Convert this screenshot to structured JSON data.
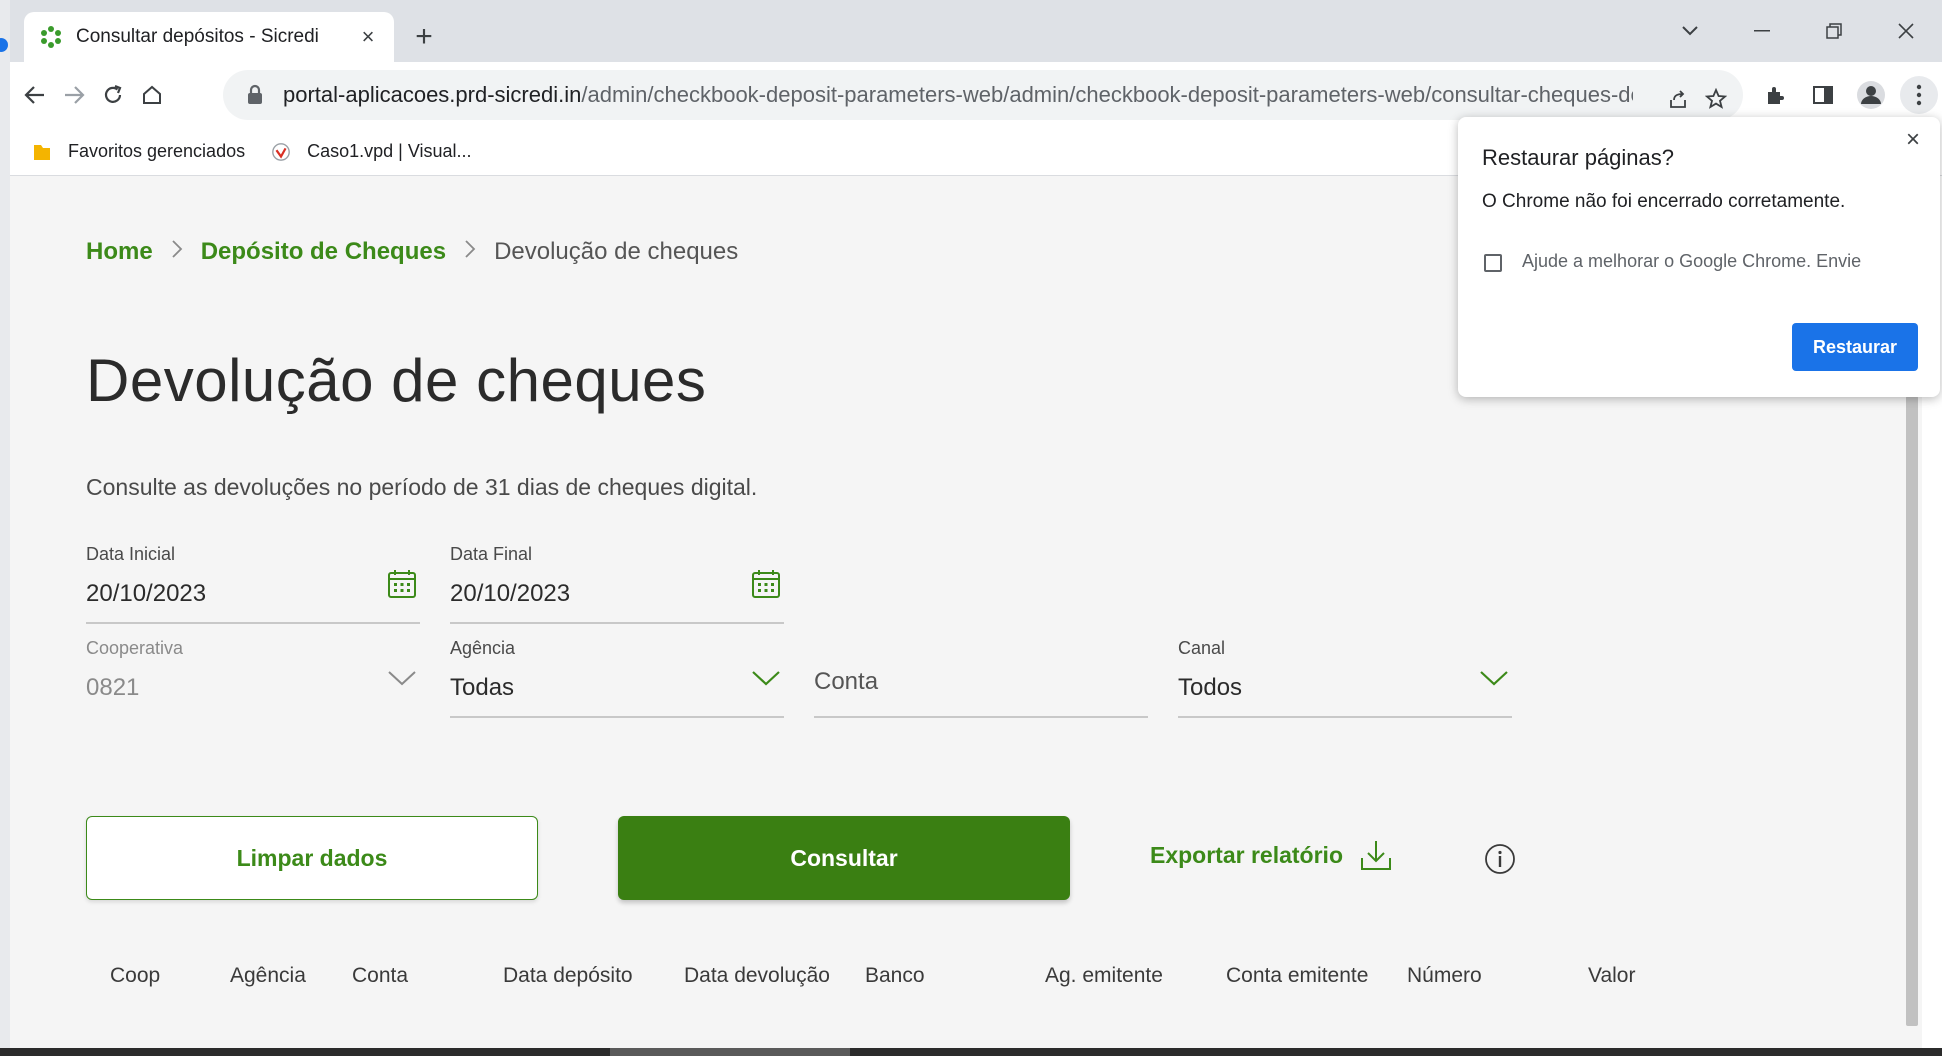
{
  "browser": {
    "tab_title": "Consultar depósitos - Sicredi",
    "tab_close": "×",
    "new_tab": "+",
    "url_host": "portal-aplicacoes.prd-sicredi.in",
    "url_path": "/admin/checkbook-deposit-parameters-web/admin/checkbook-deposit-parameters-web/consultar-cheques-dev...",
    "bookmarks": [
      {
        "label": "Favoritos gerenciados",
        "icon": "folder-icon"
      },
      {
        "label": "Caso1.vpd | Visual...",
        "icon": "visual-paradigm-icon"
      }
    ]
  },
  "restore_popup": {
    "title": "Restaurar páginas?",
    "message": "O Chrome não foi encerrado corretamente.",
    "checkbox_label": "Ajude a melhorar o Google Chrome. Envie",
    "checkbox_checked": false,
    "button": "Restaurar",
    "close": "×"
  },
  "breadcrumb": {
    "items": [
      "Home",
      "Depósito de Cheques"
    ],
    "current": "Devolução de cheques"
  },
  "page": {
    "title": "Devolução de cheques",
    "subtitle": "Consulte as devoluções no período de 31 dias de cheques digital."
  },
  "filters": {
    "data_inicial": {
      "label": "Data Inicial",
      "value": "20/10/2023"
    },
    "data_final": {
      "label": "Data Final",
      "value": "20/10/2023"
    },
    "cooperativa": {
      "label": "Cooperativa",
      "value": "0821"
    },
    "agencia": {
      "label": "Agência",
      "value": "Todas"
    },
    "conta": {
      "placeholder": "Conta"
    },
    "canal": {
      "label": "Canal",
      "value": "Todos"
    }
  },
  "actions": {
    "limpar": "Limpar dados",
    "consultar": "Consultar",
    "exportar": "Exportar relatório"
  },
  "table": {
    "columns": [
      "Coop",
      "Agência",
      "Conta",
      "Data depósito",
      "Data devolução",
      "Banco",
      "Ag. emitente",
      "Conta emitente",
      "Número",
      "Valor"
    ]
  },
  "colors": {
    "brand_green": "#3c8a19",
    "primary_button": "#3a7f12",
    "chrome_blue": "#1a73e8"
  }
}
